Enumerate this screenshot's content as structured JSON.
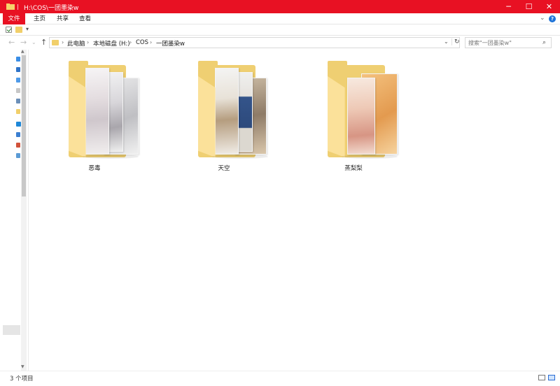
{
  "window": {
    "title": "H:\\COS\\一团墨染w",
    "controls": {
      "minimize": "─",
      "maximize": "☐",
      "close": "✕"
    }
  },
  "ribbon": {
    "tabs": [
      "文件",
      "主页",
      "共享",
      "查看"
    ],
    "expand_glyph": "⌄",
    "help_glyph": "?"
  },
  "quick_access": {
    "dropdown_glyph": "▾"
  },
  "nav": {
    "back": "←",
    "forward": "→",
    "recent": "⌄",
    "up": "↑"
  },
  "address": {
    "crumbs": [
      "此电脑",
      "本地磁盘 (H:)",
      "COS",
      "一团墨染w"
    ],
    "separator": "›",
    "dropdown_glyph": "⌄",
    "refresh_glyph": "↻"
  },
  "search": {
    "placeholder": "搜索\"一团墨染w\"",
    "icon_glyph": "⌕"
  },
  "folders": [
    {
      "name": "恶毒"
    },
    {
      "name": "天空"
    },
    {
      "name": "蒸梨梨"
    }
  ],
  "status": {
    "item_count": "3 个项目"
  },
  "colors": {
    "accent": "#e81123",
    "folder": "#efcf72",
    "selection": "#cfe3fb"
  }
}
